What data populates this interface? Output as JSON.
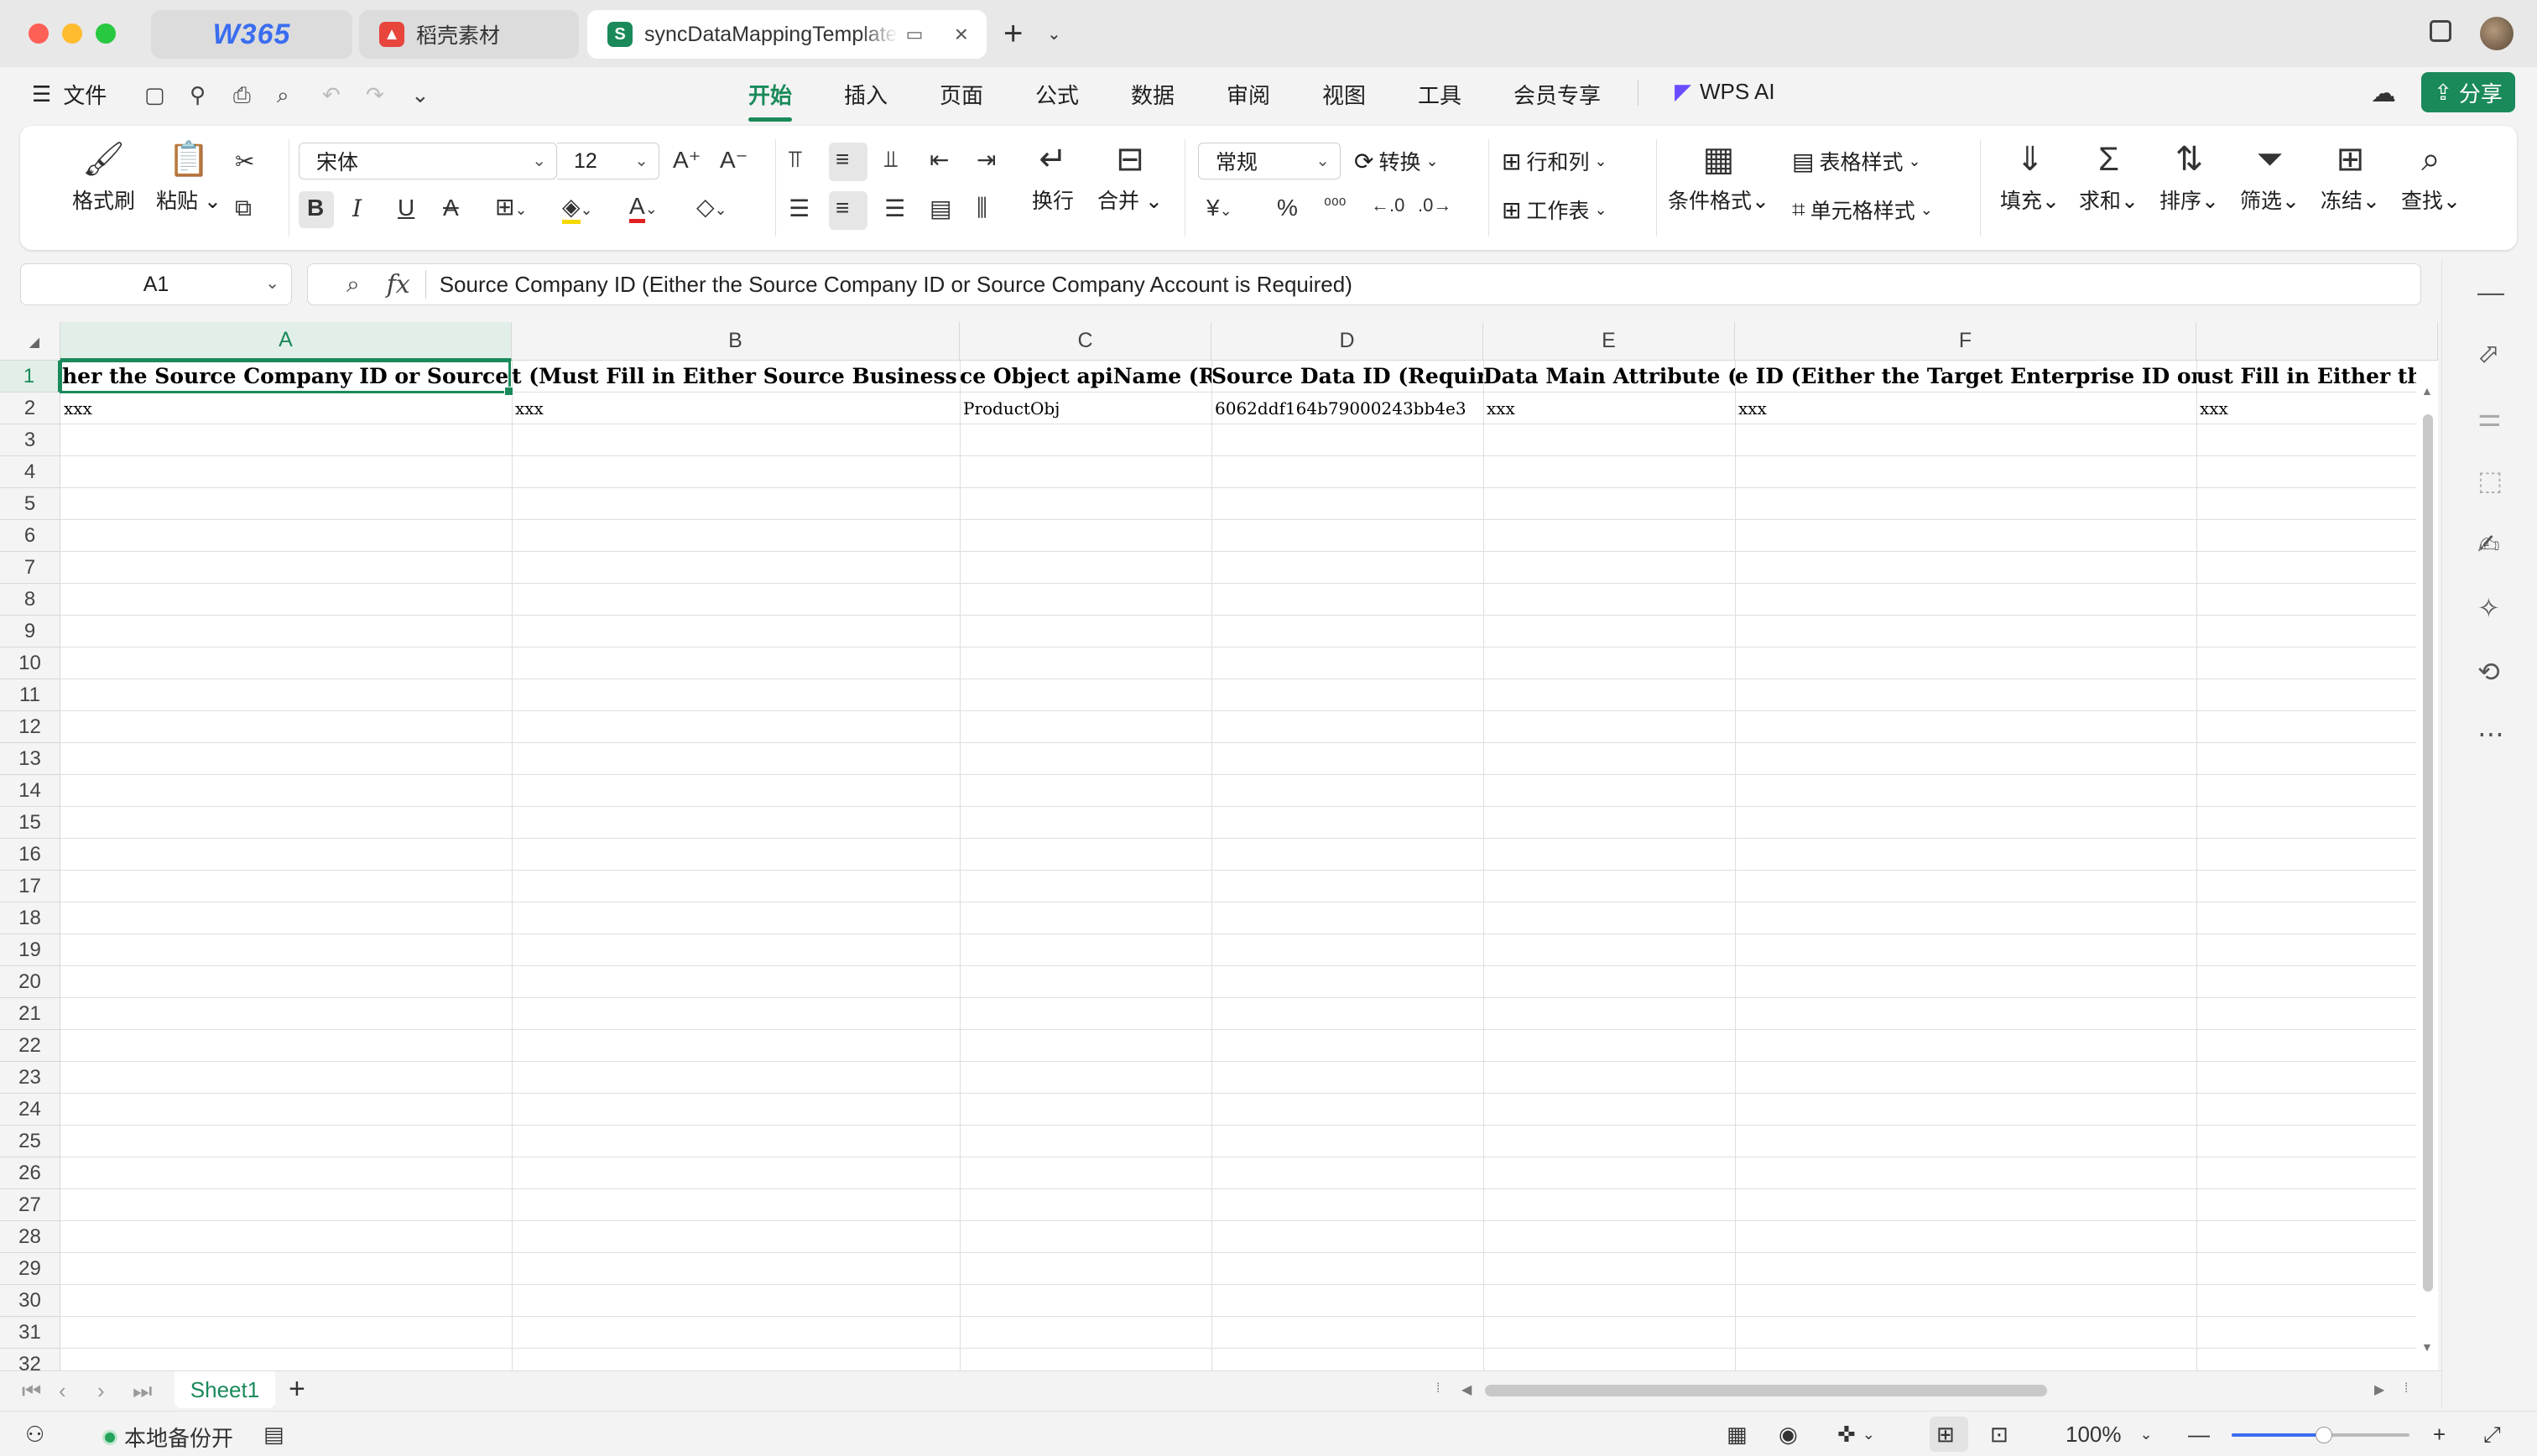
{
  "tabs": [
    {
      "label": "W365",
      "icon": "w365-logo-icon"
    },
    {
      "label": "稻壳素材",
      "icon": "daoke-icon"
    },
    {
      "label": "syncDataMappingTemplate",
      "icon": "spreadsheet-s-icon",
      "active": true
    }
  ],
  "menubar": {
    "file_label": "文件",
    "tabs": [
      "开始",
      "插入",
      "页面",
      "公式",
      "数据",
      "审阅",
      "视图",
      "工具",
      "会员专享"
    ],
    "active_tab": "开始",
    "ai_label": "WPS AI",
    "share_label": "分享"
  },
  "ribbon": {
    "format_painter": "格式刷",
    "paste": "粘贴",
    "font_name": "宋体",
    "font_size": "12",
    "wrap": "换行",
    "merge": "合并",
    "number_format": "常规",
    "convert": "转换",
    "rows_cols": "行和列",
    "worksheet": "工作表",
    "conditional_format": "条件格式",
    "table_style": "表格样式",
    "cell_style": "单元格样式",
    "fill": "填充",
    "sum": "求和",
    "sort": "排序",
    "filter": "筛选",
    "freeze": "冻结",
    "find": "查找"
  },
  "formula_bar": {
    "cell_ref": "A1",
    "fx": "fx",
    "value": "Source Company ID (Either the Source Company ID or Source Company Account is Required)"
  },
  "grid": {
    "columns": [
      "A",
      "B",
      "C",
      "D",
      "E",
      "F"
    ],
    "row_numbers": [
      "1",
      "2",
      "3",
      "4",
      "5",
      "6",
      "7",
      "8",
      "9",
      "10",
      "11",
      "12",
      "13",
      "14",
      "15",
      "16",
      "17",
      "18",
      "19",
      "20",
      "21",
      "22",
      "23",
      "24",
      "25",
      "26",
      "27",
      "28",
      "29",
      "30",
      "31",
      "32"
    ],
    "row1": [
      "her the Source Company ID or Source Compa",
      "t (Must Fill in Either Source Business Accoun",
      "ce Object apiName (Requ",
      "Source Data ID (Required)",
      "Data Main Attribute (Res",
      "e ID (Either the Target Enterprise ID or Acco",
      "ust Fill in Either the T"
    ],
    "row2": [
      "xxx",
      "xxx",
      "ProductObj",
      "6062ddf164b79000243bb4e3",
      "xxx",
      "xxx",
      "xxx"
    ]
  },
  "sheets": {
    "active": "Sheet1"
  },
  "statusbar": {
    "backup_label": "本地备份开",
    "zoom": "100%",
    "zoom_level": 0.52
  }
}
